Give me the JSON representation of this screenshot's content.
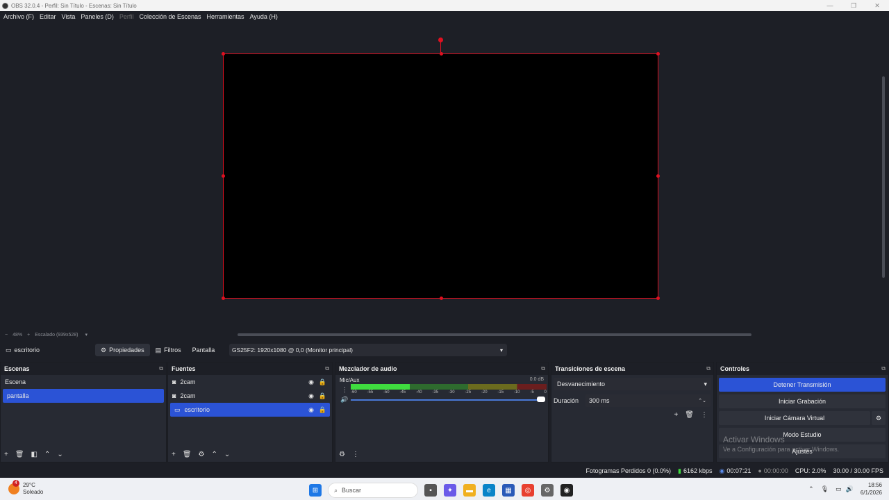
{
  "window": {
    "title": "OBS 32.0.4 - Perfil: Sin Título - Escenas: Sin Título",
    "buttons": [
      "—",
      "❐",
      "✕"
    ]
  },
  "menu": [
    "Archivo (F)",
    "Editar",
    "Vista",
    "Paneles (D)",
    "Perfil",
    "Colección de Escenas",
    "Herramientas",
    "Ayuda (H)"
  ],
  "zoom": {
    "minus": "−",
    "value": "48%",
    "plus": "+",
    "scale_label": "Escalado (939x528)"
  },
  "source_toolbar": {
    "source_name": "escritorio",
    "properties": "Propiedades",
    "filters": "Filtros",
    "display_label": "Pantalla",
    "display_value": "GS25F2: 1920x1080 @ 0,0 (Monitor principal)"
  },
  "scenes": {
    "title": "Escenas",
    "items": [
      "Escena",
      "pantalla"
    ],
    "selected": 1
  },
  "sources": {
    "title": "Fuentes",
    "items": [
      {
        "name": "2cam",
        "icon": "camera-icon"
      },
      {
        "name": "2cam",
        "icon": "camera-icon"
      },
      {
        "name": "escritorio",
        "icon": "monitor-icon"
      }
    ],
    "selected": 2
  },
  "mixer": {
    "title": "Mezclador de audio",
    "channel": "Mic/Aux",
    "level": "0.0 dB",
    "ticks": [
      "-60",
      "-55",
      "-50",
      "-45",
      "-40",
      "-35",
      "-30",
      "-25",
      "-20",
      "-15",
      "-10",
      "-5",
      "0"
    ]
  },
  "transitions": {
    "title": "Transiciones de escena",
    "type": "Desvanecimiento",
    "duration_label": "Duración",
    "duration_value": "300 ms"
  },
  "controls": {
    "title": "Controles",
    "stop_stream": "Detener Transmisión",
    "start_record": "Iniciar Grabación",
    "virtual_cam": "Iniciar Cámara Virtual",
    "studio_mode": "Modo Estudio",
    "settings": "Ajustes"
  },
  "watermark": {
    "line1": "Activar Windows",
    "line2": "Ve a Configuración para activar Windows."
  },
  "status": {
    "frames_dropped": "Fotogramas Perdidos 0 (0.0%)",
    "bitrate": "6162 kbps",
    "stream_time": "00:07:21",
    "record_time": "00:00:00",
    "cpu": "CPU: 2.0%",
    "fps": "30.00 / 30.00 FPS"
  },
  "taskbar": {
    "weather_temp": "29°C",
    "weather_desc": "Soleado",
    "badge": "4",
    "search": "Buscar",
    "time": "18:56",
    "date": "6/1/2026"
  }
}
